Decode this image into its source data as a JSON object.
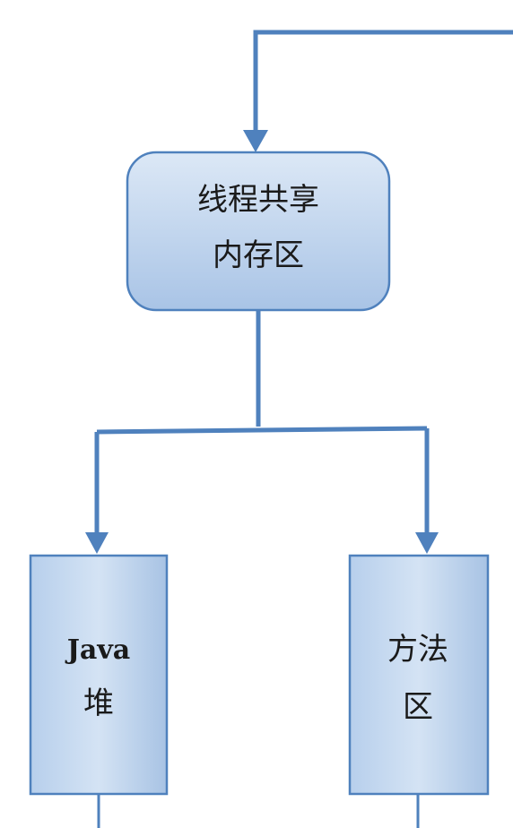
{
  "nodes": {
    "shared_memory": {
      "line1": "线程共享",
      "line2": "内存区"
    },
    "java_heap": {
      "line1": "Java",
      "line2": "堆"
    },
    "method_area": {
      "line1": "方法",
      "line2": "区"
    }
  },
  "colors": {
    "connector": "#4f81bd",
    "box_fill_top": "#dce8f6",
    "box_fill_bottom": "#a9c4e6",
    "box_border": "#4f81bd",
    "text": "#1a1a1a"
  }
}
